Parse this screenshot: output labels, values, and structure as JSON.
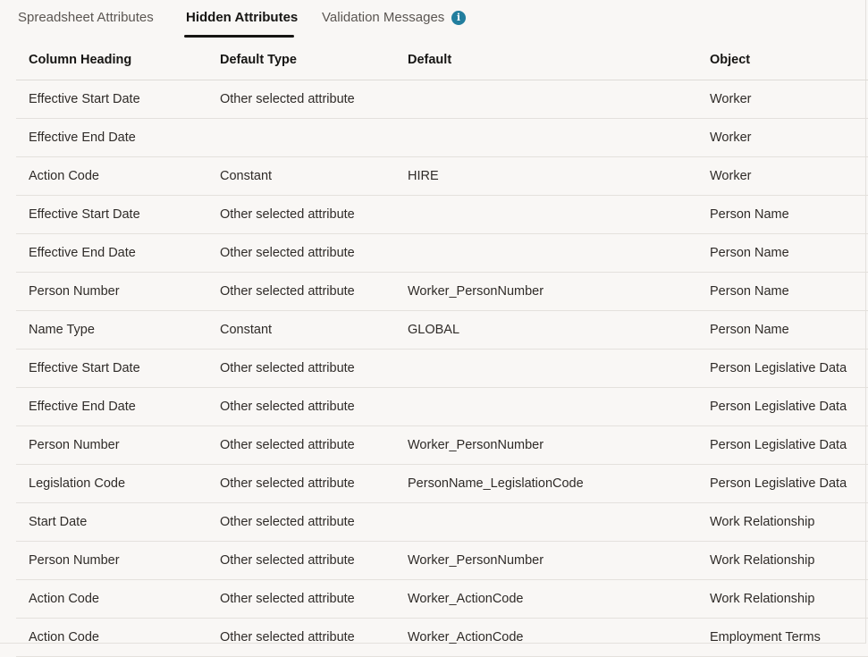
{
  "tabs": [
    {
      "label": "Spreadsheet Attributes",
      "selected": false
    },
    {
      "label": "Hidden Attributes",
      "selected": true
    },
    {
      "label": "Validation Messages",
      "selected": false
    }
  ],
  "info_icon_glyph": "i",
  "table": {
    "headers": [
      "Column Heading",
      "Default Type",
      "Default",
      "Object"
    ],
    "rows": [
      [
        "Effective Start Date",
        "Other selected attribute",
        "",
        "Worker"
      ],
      [
        "Effective End Date",
        "",
        "",
        "Worker"
      ],
      [
        "Action Code",
        "Constant",
        "HIRE",
        "Worker"
      ],
      [
        "Effective Start Date",
        "Other selected attribute",
        "",
        "Person Name"
      ],
      [
        "Effective End Date",
        "Other selected attribute",
        "",
        "Person Name"
      ],
      [
        "Person Number",
        "Other selected attribute",
        "Worker_PersonNumber",
        "Person Name"
      ],
      [
        "Name Type",
        "Constant",
        "GLOBAL",
        "Person Name"
      ],
      [
        "Effective Start Date",
        "Other selected attribute",
        "",
        "Person Legislative Data"
      ],
      [
        "Effective End Date",
        "Other selected attribute",
        "",
        "Person Legislative Data"
      ],
      [
        "Person Number",
        "Other selected attribute",
        "Worker_PersonNumber",
        "Person Legislative Data"
      ],
      [
        "Legislation Code",
        "Other selected attribute",
        "PersonName_LegislationCode",
        "Person Legislative Data"
      ],
      [
        "Start Date",
        "Other selected attribute",
        "",
        "Work Relationship"
      ],
      [
        "Person Number",
        "Other selected attribute",
        "Worker_PersonNumber",
        "Work Relationship"
      ],
      [
        "Action Code",
        "Other selected attribute",
        "Worker_ActionCode",
        "Work Relationship"
      ],
      [
        "Action Code",
        "Other selected attribute",
        "Worker_ActionCode",
        "Employment Terms"
      ]
    ]
  },
  "colors": {
    "background": "#f9f7f5",
    "text": "#161513",
    "info_icon": "#227e9e"
  }
}
